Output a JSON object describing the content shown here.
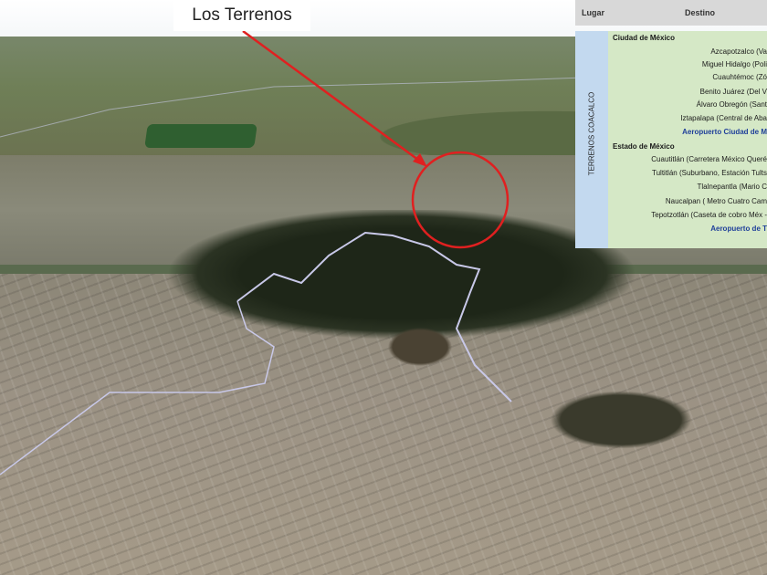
{
  "callout": {
    "label": "Los Terrenos"
  },
  "table": {
    "headers": {
      "lugar": "Lugar",
      "destino": "Destino"
    },
    "lugar_label": "TERRENOS COACALCO",
    "groups": [
      {
        "title": "Ciudad de México",
        "items": [
          "Azcapotzalco (Va",
          "Miguel Hidalgo (Poli",
          "Cuauhtémoc (Zó",
          "Benito Juárez (Del V",
          "Álvaro Obregón (Sant",
          "Iztapalapa (Central de Aba"
        ],
        "airport": "Aeropuerto Ciudad de M"
      },
      {
        "title": "Estado de México",
        "items": [
          "Cuautitlán (Carretera México Queré",
          "Tultitlán (Suburbano, Estación Tults",
          "Tlalnepantla (Mario C",
          "Naucalpan ( Metro Cuatro Cam",
          "Tepotzotlán (Caseta de cobro Méx -"
        ],
        "airport": "Aeropuerto de T"
      }
    ]
  },
  "colors": {
    "arrow": "#e02020",
    "circle": "#e02020",
    "airport_text": "#1f3f9a",
    "table_bg": "#d5e8c6",
    "lugar_bg": "#c3d9ef",
    "header_bg": "#d8d8d8"
  }
}
